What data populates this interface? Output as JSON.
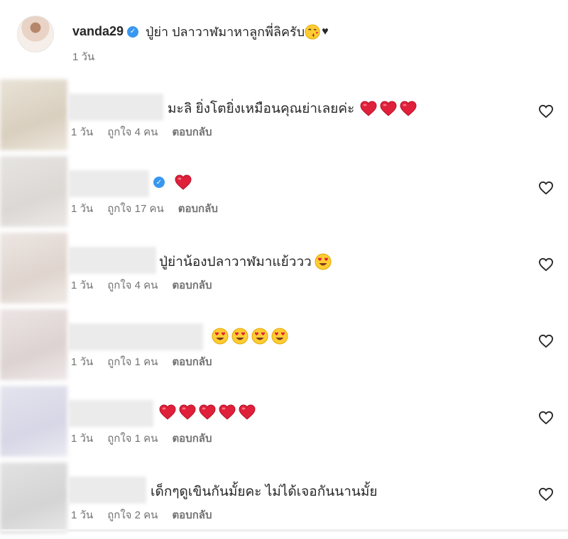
{
  "caption": {
    "username": "vanda29",
    "text": "ปู่ย่า ปลาวาฬมาหาลูกพี่ลิครับ",
    "time": "1 วัน"
  },
  "comments": [
    {
      "text": "มะลิ ยิ่งโตยิ่งเหมือนคุณย่าเลยค่ะ",
      "time": "1 วัน",
      "likes": "ถูกใจ 4 คน",
      "reply": "ตอบกลับ"
    },
    {
      "text": "",
      "time": "1 วัน",
      "likes": "ถูกใจ 17 คน",
      "reply": "ตอบกลับ"
    },
    {
      "text": "ปู่ย่าน้องปลาวาฬมาแย้ววว",
      "time": "1 วัน",
      "likes": "ถูกใจ 4 คน",
      "reply": "ตอบกลับ"
    },
    {
      "text": "",
      "time": "1 วัน",
      "likes": "ถูกใจ 1 คน",
      "reply": "ตอบกลับ"
    },
    {
      "text": "",
      "time": "1 วัน",
      "likes": "ถูกใจ 1 คน",
      "reply": "ตอบกลับ"
    },
    {
      "text": "เด็กๆดูเขินกันมั้ยคะ ไม่ได้เจอกันนานมั้ย",
      "time": "1 วัน",
      "likes": "ถูกใจ 2 คน",
      "reply": "ตอบกลับ"
    }
  ],
  "colors": {
    "verified": "#3897f0",
    "heart": "#e0203a",
    "meta": "#737373"
  },
  "icons": [
    "verified-badge-icon",
    "kiss-emoji-icon",
    "black-heart-icon",
    "red-heart-icon",
    "heart-eyes-emoji-icon",
    "like-heart-outline-icon"
  ]
}
